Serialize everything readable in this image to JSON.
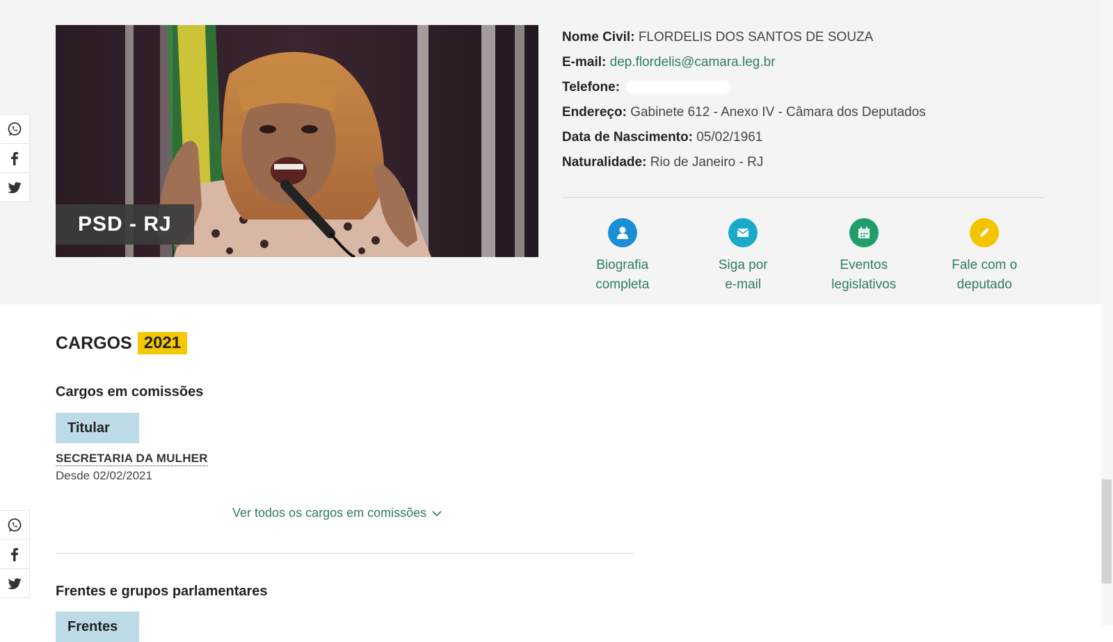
{
  "profile": {
    "party": "PSD - RJ",
    "fields": [
      {
        "label": "Nome Civil:",
        "value": "FLORDELIS DOS SANTOS DE SOUZA"
      },
      {
        "label": "E-mail:",
        "value": "dep.flordelis@camara.leg.br"
      },
      {
        "label": "Telefone:",
        "value": ""
      },
      {
        "label": "Endereço:",
        "value": "Gabinete 612 - Anexo IV - Câmara dos Deputados"
      },
      {
        "label": "Data de Nascimento:",
        "value": "05/02/1961"
      },
      {
        "label": "Naturalidade:",
        "value": "Rio de Janeiro - RJ"
      }
    ]
  },
  "actions": [
    {
      "line1": "Biografia",
      "line2": "completa",
      "icon": "person-icon",
      "color": "#1b8fd6"
    },
    {
      "line1": "Siga por",
      "line2": "e-mail",
      "icon": "envelope-icon",
      "color": "#19a9c9"
    },
    {
      "line1": "Eventos",
      "line2": "legislativos",
      "icon": "calendar-icon",
      "color": "#1f9e6a"
    },
    {
      "line1": "Fale com o",
      "line2": "deputado",
      "icon": "pencil-icon",
      "color": "#f5c400"
    }
  ],
  "cargos": {
    "title": "CARGOS",
    "year": "2021",
    "committees_heading": "Cargos em comissões",
    "role_tag": "Titular",
    "committee_name": "SECRETARIA DA MULHER",
    "since": "Desde 02/02/2021",
    "see_all": "Ver todos os cargos em comissões",
    "fronts_heading": "Frentes e grupos parlamentares",
    "fronts_tag": "Frentes"
  },
  "social": [
    "whatsapp-icon",
    "facebook-icon",
    "twitter-icon"
  ],
  "colors": {
    "accent_green": "#2e7d5b",
    "year_yellow": "#f5c800",
    "tag_blue": "#bcdbe6",
    "band_gray": "#f4f4f4"
  }
}
